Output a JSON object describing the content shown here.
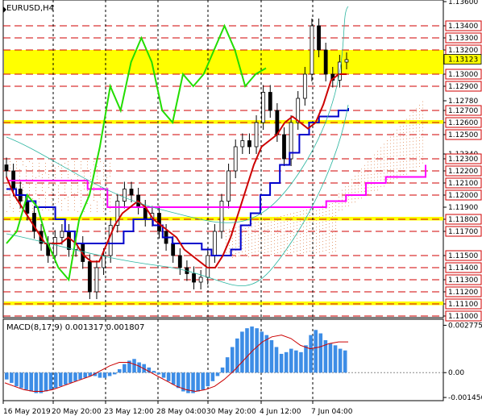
{
  "chart_data": [
    {
      "type": "line",
      "title": "EURUSD,H4",
      "x_ticks": [
        "16 May 2019",
        "20 May 20:00",
        "23 May 12:00",
        "28 May 04:00",
        "30 May 20:00",
        "4 Jun 12:00",
        "7 Jun 04:00"
      ],
      "ylim": [
        1.11,
        1.136
      ],
      "y_ticks": [
        "1.13600",
        "1.13400",
        "1.13300",
        "1.13200",
        "1.13000",
        "1.12900",
        "1.12780",
        "1.12700",
        "1.12600",
        "1.12500",
        "1.12340",
        "1.12300",
        "1.12200",
        "1.12100",
        "1.12000",
        "1.11900",
        "1.11800",
        "1.11700",
        "1.11500",
        "1.11400",
        "1.11300",
        "1.11200",
        "1.11100",
        "1.11000"
      ],
      "current_price": "1.13123",
      "support_resistance_levels": [
        1.134,
        1.133,
        1.132,
        1.13,
        1.129,
        1.127,
        1.126,
        1.125,
        1.123,
        1.122,
        1.121,
        1.12,
        1.118,
        1.117,
        1.115,
        1.114,
        1.113,
        1.112,
        1.111,
        1.11
      ],
      "highlight_zones": [
        [
          1.13,
          1.132
        ],
        [
          1.1259,
          1.1262
        ],
        [
          1.1179,
          1.1182
        ],
        [
          1.1109,
          1.1112
        ]
      ],
      "series": [
        {
          "name": "price",
          "values": [
            1.122,
            1.1205,
            1.1195,
            1.1185,
            1.117,
            1.116,
            1.115,
            1.1165,
            1.117,
            1.1155,
            1.116,
            1.1145,
            1.112,
            1.114,
            1.115,
            1.1175,
            1.1195,
            1.1205,
            1.12,
            1.119,
            1.118,
            1.1185,
            1.117,
            1.116,
            1.115,
            1.114,
            1.1135,
            1.1128,
            1.1132,
            1.115,
            1.117,
            1.1195,
            1.122,
            1.124,
            1.1245,
            1.124,
            1.126,
            1.1285,
            1.127,
            1.125,
            1.123,
            1.126,
            1.128,
            1.13,
            1.134,
            1.132,
            1.13,
            1.1295,
            1.131,
            1.1312
          ]
        },
        {
          "name": "tenkan",
          "values": [
            1.1215,
            1.12,
            1.119,
            1.118,
            1.117,
            1.116,
            1.116,
            1.116,
            1.1165,
            1.116,
            1.115,
            1.1145,
            1.1145,
            1.116,
            1.1175,
            1.1185,
            1.119,
            1.1195,
            1.119,
            1.118,
            1.1175,
            1.117,
            1.1165,
            1.1155,
            1.115,
            1.1145,
            1.114,
            1.114,
            1.115,
            1.1165,
            1.1185,
            1.1205,
            1.1225,
            1.124,
            1.1245,
            1.125,
            1.126,
            1.1265,
            1.126,
            1.1255,
            1.126,
            1.1275,
            1.1295,
            1.13,
            1.13
          ]
        },
        {
          "name": "kijun",
          "values": [
            1.1205,
            1.12,
            1.1195,
            1.119,
            1.119,
            1.118,
            1.117,
            1.116,
            1.116,
            1.116,
            1.116,
            1.116,
            1.117,
            1.118,
            1.118,
            1.1175,
            1.1165,
            1.116,
            1.116,
            1.116,
            1.1155,
            1.115,
            1.115,
            1.1155,
            1.1175,
            1.1185,
            1.12,
            1.121,
            1.1225,
            1.1235,
            1.125,
            1.126,
            1.1265,
            1.1265,
            1.127,
            1.1272
          ]
        },
        {
          "name": "chikou",
          "values": [
            1.116,
            1.117,
            1.12,
            1.119,
            1.116,
            1.114,
            1.113,
            1.118,
            1.12,
            1.124,
            1.129,
            1.127,
            1.131,
            1.133,
            1.131,
            1.127,
            1.126,
            1.13,
            1.129,
            1.13,
            1.132,
            1.134,
            1.132,
            1.129,
            1.13,
            1.1305
          ]
        },
        {
          "name": "senkou_b",
          "values": [
            1.1212,
            1.1212,
            1.1212,
            1.1212,
            1.1205,
            1.119,
            1.119,
            1.119,
            1.119,
            1.119,
            1.119,
            1.119,
            1.119,
            1.119,
            1.119,
            1.119,
            1.1195,
            1.12,
            1.121,
            1.1215,
            1.1215,
            1.1225
          ]
        }
      ]
    },
    {
      "type": "bar",
      "title": "MACD(8,17,9) 0.001317 0.001807",
      "ylim": [
        -0.0015,
        0.00275
      ],
      "y_ticks": [
        "0.002775",
        "0.00",
        "-0.001456"
      ],
      "series": [
        {
          "name": "histogram",
          "values": [
            -0.0004,
            -0.0006,
            -0.0008,
            -0.0009,
            -0.001,
            -0.0011,
            -0.0012,
            -0.0012,
            -0.0011,
            -0.001,
            -0.0009,
            -0.0008,
            -0.0007,
            -0.0006,
            -0.0005,
            -0.0004,
            -0.0003,
            -0.0002,
            -0.0002,
            -0.0003,
            -0.0003,
            -0.0002,
            -0.0001,
            0.0002,
            0.0005,
            0.0007,
            0.0008,
            0.0006,
            0.0005,
            0.0003,
            0.0001,
            -0.0001,
            -0.0003,
            -0.0005,
            -0.0007,
            -0.0009,
            -0.0011,
            -0.0012,
            -0.0012,
            -0.0011,
            -0.001,
            -0.0008,
            -0.0005,
            -0.0002,
            0.0003,
            0.0009,
            0.0015,
            0.002,
            0.0024,
            0.0026,
            0.0027,
            0.0026,
            0.0024,
            0.0022,
            0.0019,
            0.0015,
            0.0011,
            0.0012,
            0.0014,
            0.0013,
            0.0012,
            0.0016,
            0.0022,
            0.0025,
            0.0023,
            0.0019,
            0.0017,
            0.0016,
            0.0014,
            0.0013
          ]
        },
        {
          "name": "signal",
          "values": [
            -0.0006,
            -0.0008,
            -0.001,
            -0.0011,
            -0.0011,
            -0.001,
            -0.0008,
            -0.0006,
            -0.0004,
            -0.0002,
            0.0001,
            0.0004,
            0.0006,
            0.0006,
            0.0004,
            0.0001,
            -0.0002,
            -0.0005,
            -0.0008,
            -0.001,
            -0.0011,
            -0.001,
            -0.0008,
            -0.0004,
            0.0001,
            0.0007,
            0.0013,
            0.0018,
            0.0021,
            0.0022,
            0.002,
            0.0016,
            0.0014,
            0.0015,
            0.0017,
            0.0018,
            0.0018
          ]
        }
      ]
    }
  ]
}
